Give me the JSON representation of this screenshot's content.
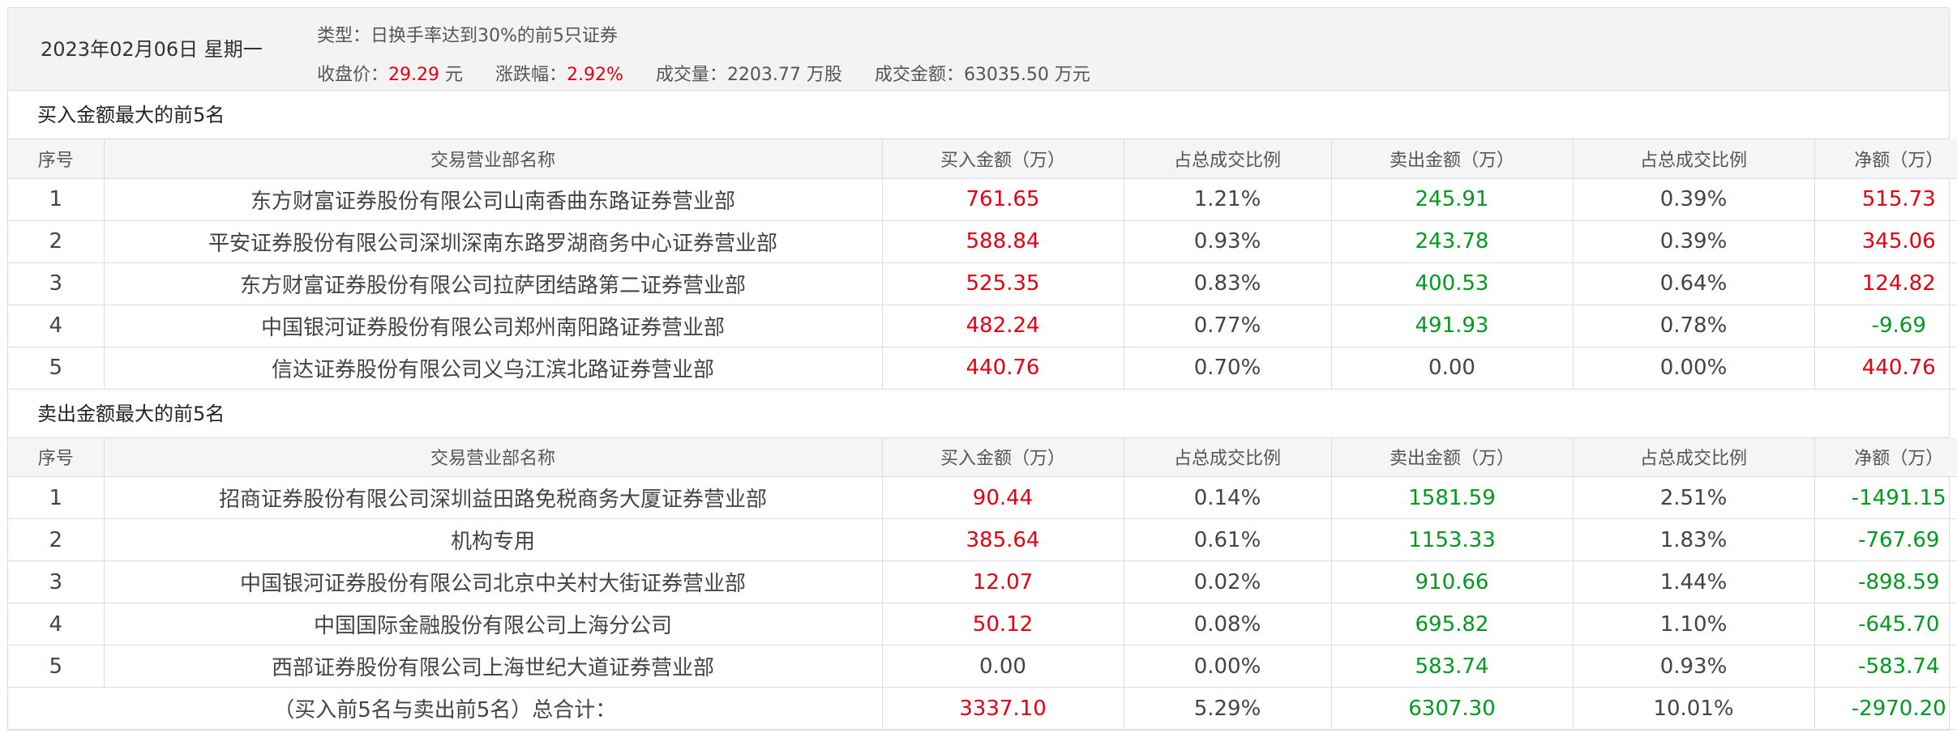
{
  "header": {
    "date": "2023年02月06日 星期一",
    "type_label": "类型：",
    "type_value": "日换手率达到30%的前5只证券",
    "close_label": "收盘价：",
    "close_value": "29.29",
    "close_unit": "元",
    "change_label": "涨跌幅：",
    "change_value": "2.92%",
    "volume_label": "成交量：",
    "volume_value": "2203.77 万股",
    "turnover_label": "成交金额：",
    "turnover_value": "63035.50 万元"
  },
  "colors": {
    "up": "#e60012",
    "down": "#009b1e"
  },
  "columns": [
    "序号",
    "交易营业部名称",
    "买入金额（万）",
    "占总成交比例",
    "卖出金额（万）",
    "占总成交比例",
    "净额（万）"
  ],
  "buy_section": {
    "title": "买入金额最大的前5名",
    "rows": [
      {
        "no": "1",
        "name": "东方财富证券股份有限公司山南香曲东路证券营业部",
        "buy": "761.65",
        "buy_pct": "1.21%",
        "sell": "245.91",
        "sell_pct": "0.39%",
        "net": "515.73",
        "net_sign": "up"
      },
      {
        "no": "2",
        "name": "平安证券股份有限公司深圳深南东路罗湖商务中心证券营业部",
        "buy": "588.84",
        "buy_pct": "0.93%",
        "sell": "243.78",
        "sell_pct": "0.39%",
        "net": "345.06",
        "net_sign": "up"
      },
      {
        "no": "3",
        "name": "东方财富证券股份有限公司拉萨团结路第二证券营业部",
        "buy": "525.35",
        "buy_pct": "0.83%",
        "sell": "400.53",
        "sell_pct": "0.64%",
        "net": "124.82",
        "net_sign": "up"
      },
      {
        "no": "4",
        "name": "中国银河证券股份有限公司郑州南阳路证券营业部",
        "buy": "482.24",
        "buy_pct": "0.77%",
        "sell": "491.93",
        "sell_pct": "0.78%",
        "net": "-9.69",
        "net_sign": "down"
      },
      {
        "no": "5",
        "name": "信达证券股份有限公司义乌江滨北路证券营业部",
        "buy": "440.76",
        "buy_pct": "0.70%",
        "sell": "0.00",
        "sell_pct": "0.00%",
        "net": "440.76",
        "net_sign": "up"
      }
    ]
  },
  "sell_section": {
    "title": "卖出金额最大的前5名",
    "rows": [
      {
        "no": "1",
        "name": "招商证券股份有限公司深圳益田路免税商务大厦证券营业部",
        "buy": "90.44",
        "buy_pct": "0.14%",
        "sell": "1581.59",
        "sell_pct": "2.51%",
        "net": "-1491.15",
        "net_sign": "down"
      },
      {
        "no": "2",
        "name": "机构专用",
        "buy": "385.64",
        "buy_pct": "0.61%",
        "sell": "1153.33",
        "sell_pct": "1.83%",
        "net": "-767.69",
        "net_sign": "down"
      },
      {
        "no": "3",
        "name": "中国银河证券股份有限公司北京中关村大街证券营业部",
        "buy": "12.07",
        "buy_pct": "0.02%",
        "sell": "910.66",
        "sell_pct": "1.44%",
        "net": "-898.59",
        "net_sign": "down"
      },
      {
        "no": "4",
        "name": "中国国际金融股份有限公司上海分公司",
        "buy": "50.12",
        "buy_pct": "0.08%",
        "sell": "695.82",
        "sell_pct": "1.10%",
        "net": "-645.70",
        "net_sign": "down"
      },
      {
        "no": "5",
        "name": "西部证券股份有限公司上海世纪大道证券营业部",
        "buy": "0.00",
        "buy_pct": "0.00%",
        "sell": "583.74",
        "sell_pct": "0.93%",
        "net": "-583.74",
        "net_sign": "down"
      }
    ]
  },
  "total": {
    "label": "（买入前5名与卖出前5名）总合计：",
    "buy": "3337.10",
    "buy_pct": "5.29%",
    "sell": "6307.30",
    "sell_pct": "10.01%",
    "net": "-2970.20"
  }
}
